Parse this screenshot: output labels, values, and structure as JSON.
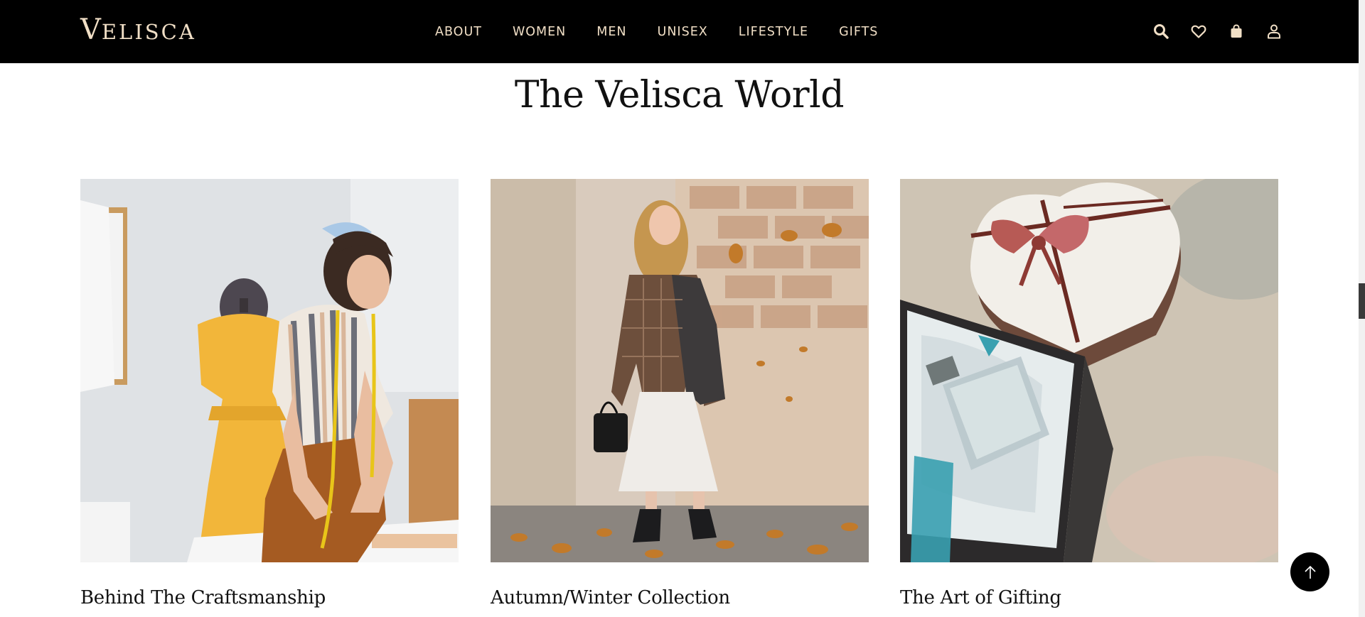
{
  "brand": {
    "logo_cap": "V",
    "logo_rest": "ELISCA"
  },
  "nav": {
    "items": [
      {
        "label": "ABOUT"
      },
      {
        "label": "WOMEN"
      },
      {
        "label": "MEN"
      },
      {
        "label": "UNISEX"
      },
      {
        "label": "LIFESTYLE"
      },
      {
        "label": "GIFTS"
      }
    ]
  },
  "header_icons": [
    "search-icon",
    "heart-icon",
    "shopping-bag-icon",
    "user-icon"
  ],
  "section": {
    "title": "The Velisca World"
  },
  "cards": [
    {
      "title": "Behind The Craftsmanship",
      "image": "tailor-at-work-image"
    },
    {
      "title": "Autumn/Winter Collection",
      "image": "autumn-fashion-model-image"
    },
    {
      "title": "The Art of Gifting",
      "image": "perfume-gift-box-image"
    }
  ],
  "colors": {
    "header_bg": "#000000",
    "accent": "#f1dfc6",
    "text": "#111111"
  }
}
